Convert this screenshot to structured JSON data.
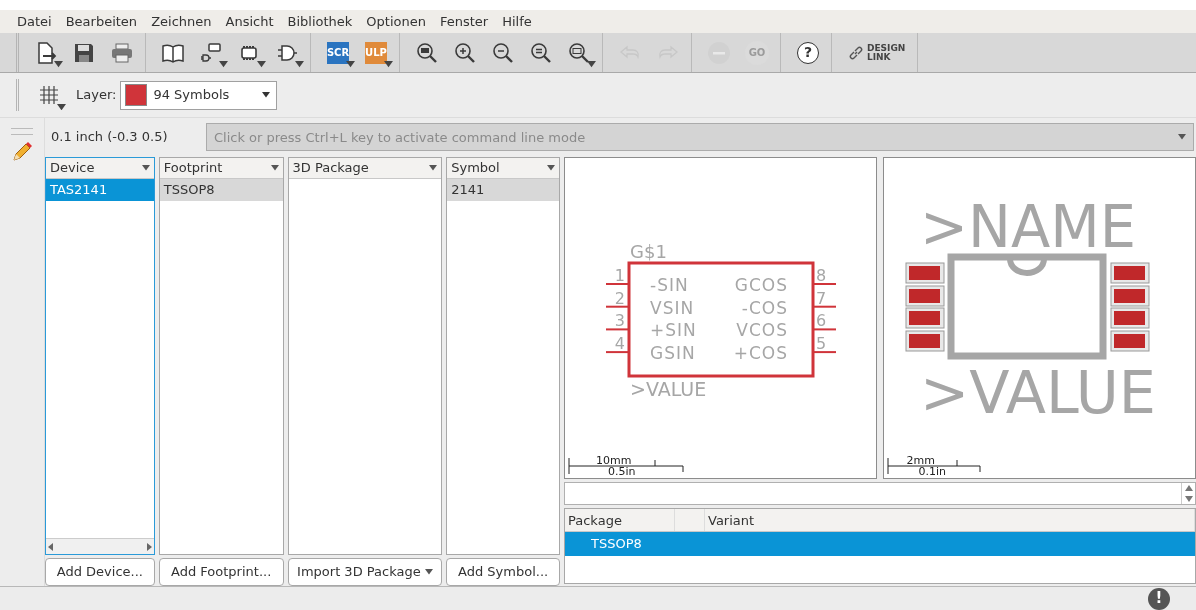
{
  "menu": [
    {
      "label": "Datei"
    },
    {
      "label": "Bearbeiten"
    },
    {
      "label": "Zeichnen"
    },
    {
      "label": "Ansicht"
    },
    {
      "label": "Bibliothek"
    },
    {
      "label": "Optionen"
    },
    {
      "label": "Fenster"
    },
    {
      "label": "Hilfe"
    }
  ],
  "toolbar": {
    "groups": [
      {
        "buttons": [
          {
            "kind": "new",
            "dropdown": true,
            "disabled": false
          },
          {
            "kind": "save",
            "dropdown": false,
            "disabled": false
          },
          {
            "kind": "print",
            "dropdown": false,
            "disabled": false
          }
        ]
      },
      {
        "buttons": [
          {
            "kind": "library",
            "dropdown": false,
            "disabled": false
          },
          {
            "kind": "device",
            "dropdown": true,
            "disabled": false
          },
          {
            "kind": "package",
            "dropdown": true,
            "disabled": false
          },
          {
            "kind": "symbol",
            "dropdown": true,
            "disabled": false
          }
        ]
      },
      {
        "buttons": [
          {
            "kind": "script",
            "label": "SCR",
            "dropdown": true,
            "disabled": false
          },
          {
            "kind": "ulp",
            "label": "ULP",
            "dropdown": true,
            "disabled": false
          }
        ]
      },
      {
        "buttons": [
          {
            "kind": "zoomfit",
            "dropdown": false,
            "disabled": false
          },
          {
            "kind": "zoomin",
            "dropdown": false,
            "disabled": false
          },
          {
            "kind": "zoomout",
            "dropdown": false,
            "disabled": false
          },
          {
            "kind": "zoomselect",
            "dropdown": false,
            "disabled": false
          },
          {
            "kind": "zoomarea",
            "dropdown": true,
            "disabled": false
          }
        ]
      },
      {
        "buttons": [
          {
            "kind": "undo",
            "dropdown": false,
            "disabled": true
          },
          {
            "kind": "redo",
            "dropdown": false,
            "disabled": true
          }
        ]
      },
      {
        "buttons": [
          {
            "kind": "stop",
            "dropdown": false,
            "disabled": true
          },
          {
            "kind": "go",
            "label": "GO",
            "dropdown": false,
            "disabled": true
          }
        ]
      },
      {
        "buttons": [
          {
            "kind": "help",
            "label": "?",
            "dropdown": false,
            "disabled": false
          }
        ]
      },
      {
        "buttons": [
          {
            "kind": "designlink",
            "lines": [
              "DESIGN",
              "LINK"
            ],
            "dropdown": false,
            "disabled": false
          }
        ]
      }
    ]
  },
  "layer_bar": {
    "label": "Layer:",
    "layer": {
      "name": "94 Symbols",
      "color": "#d0343a"
    }
  },
  "command_line": {
    "grid": "0.1 inch (-0.3 0.5)",
    "placeholder": "Click or press Ctrl+L key to activate command line mode"
  },
  "lists": [
    {
      "header": "Device",
      "focused": true,
      "scrollbar": true,
      "items": [
        {
          "text": "TAS2141",
          "selected": true
        }
      ],
      "button": {
        "label": "Add Device...",
        "dropdown": false
      }
    },
    {
      "header": "Footprint",
      "focused": false,
      "scrollbar": false,
      "items": [
        {
          "text": "TSSOP8",
          "selected": true
        }
      ],
      "button": {
        "label": "Add Footprint...",
        "dropdown": false
      }
    },
    {
      "header": "3D Package",
      "focused": false,
      "scrollbar": false,
      "button": {
        "label": "Import 3D Package",
        "dropdown": true
      }
    },
    {
      "header": "Symbol",
      "focused": false,
      "scrollbar": false,
      "items": [
        {
          "text": "2141",
          "selected": true
        }
      ],
      "button": {
        "label": "Add Symbol...",
        "dropdown": false
      }
    }
  ],
  "symbol_preview": {
    "name": "G$1",
    "value": ">VALUE",
    "left_pins": [
      {
        "number": "1",
        "name": "-SIN"
      },
      {
        "number": "2",
        "name": "VSIN"
      },
      {
        "number": "3",
        "name": "+SIN"
      },
      {
        "number": "4",
        "name": "GSIN"
      }
    ],
    "right_pins": [
      {
        "number": "8",
        "name": "GCOS"
      },
      {
        "number": "7",
        "name": "-COS"
      },
      {
        "number": "6",
        "name": "VCOS"
      },
      {
        "number": "5",
        "name": "+COS"
      }
    ],
    "scale": {
      "metric": "10mm",
      "imperial": "0.5in"
    }
  },
  "package_preview": {
    "name": ">NAME",
    "value": ">VALUE",
    "scale": {
      "metric": "2mm",
      "imperial": "0.1in"
    }
  },
  "variants": {
    "columns": [
      {
        "kind": "label",
        "label": "Package"
      },
      {
        "kind": "blank"
      },
      {
        "kind": "label",
        "label": "Variant"
      }
    ],
    "rows": [
      {
        "cells": [
          "TSSOP8"
        ],
        "selected": true
      }
    ]
  },
  "status_bar": {
    "alert": "!"
  }
}
